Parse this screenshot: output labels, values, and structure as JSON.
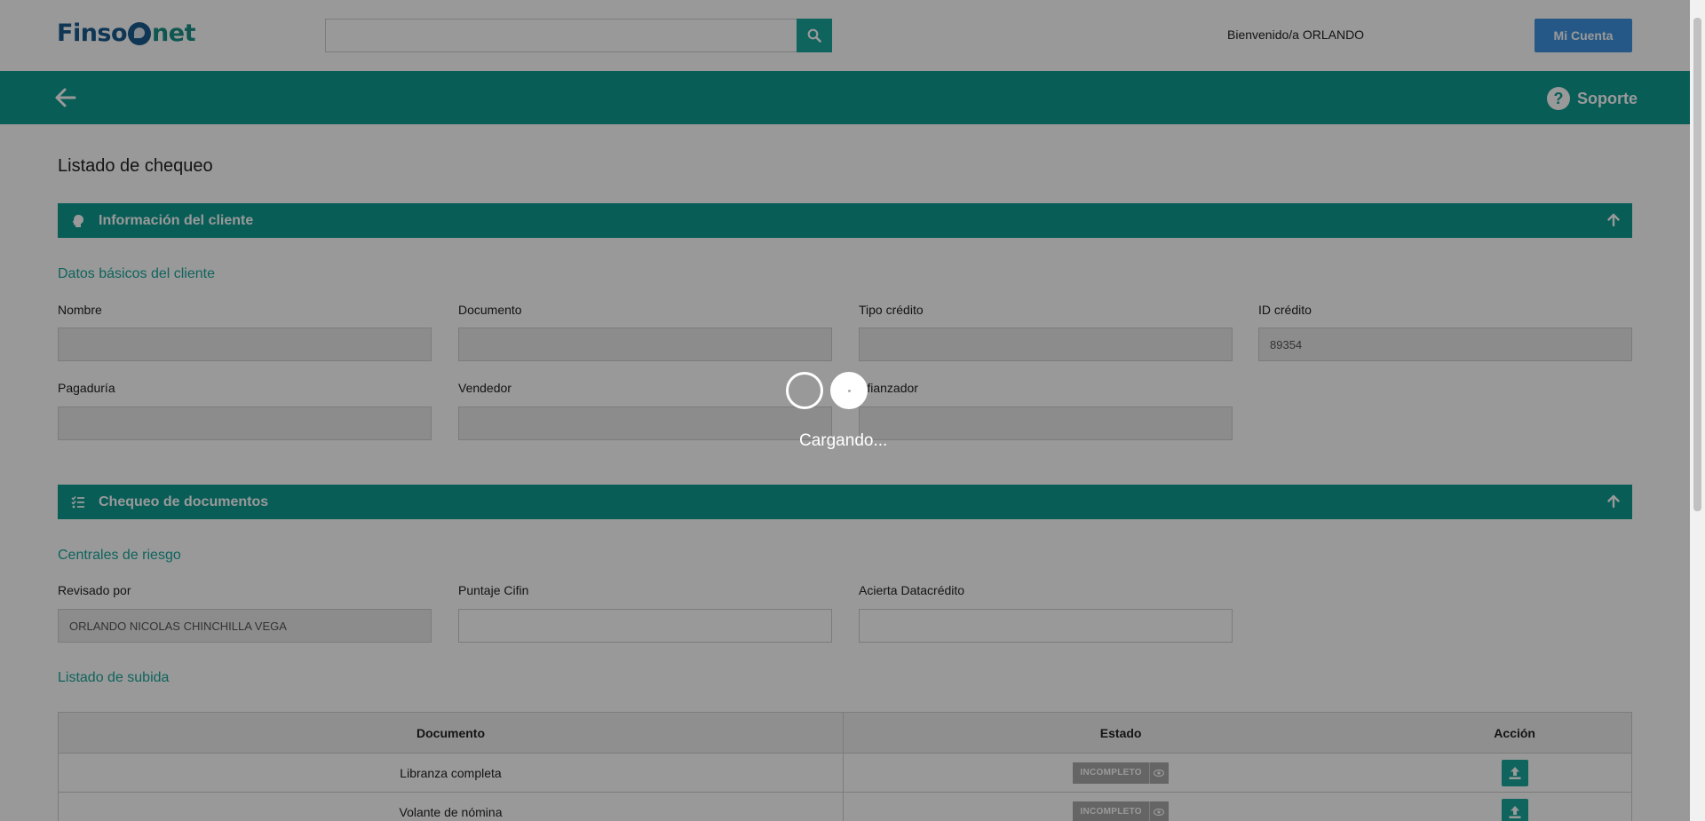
{
  "header": {
    "logo": {
      "part1": "Finso",
      "part2": "net"
    },
    "search": {
      "value": "",
      "placeholder": ""
    },
    "welcome_text": "Bienvenido/a ORLANDO",
    "account_button": "Mi Cuenta"
  },
  "navbar": {
    "support_label": "Soporte"
  },
  "page_title": "Listado de chequeo",
  "client_section": {
    "title": "Información del cliente",
    "subheading": "Datos básicos del cliente",
    "fields": {
      "nombre": {
        "label": "Nombre",
        "value": ""
      },
      "documento": {
        "label": "Documento",
        "value": ""
      },
      "tipo_credito": {
        "label": "Tipo crédito",
        "value": ""
      },
      "id_credito": {
        "label": "ID crédito",
        "value": "89354"
      },
      "pagaduria": {
        "label": "Pagaduría",
        "value": ""
      },
      "vendedor": {
        "label": "Vendedor",
        "value": ""
      },
      "afianzador": {
        "label": "Afianzador",
        "value": ""
      }
    }
  },
  "documents_section": {
    "title": "Chequeo de documentos",
    "risk_subheading": "Centrales de riesgo",
    "fields": {
      "revisado_por": {
        "label": "Revisado por",
        "value": "ORLANDO NICOLAS CHINCHILLA VEGA"
      },
      "puntaje_cifin": {
        "label": "Puntaje Cifin",
        "value": ""
      },
      "acierta_datacredito": {
        "label": "Acierta Datacrédito",
        "value": ""
      }
    },
    "upload_subheading": "Listado de subida",
    "table": {
      "headers": {
        "documento": "Documento",
        "estado": "Estado",
        "accion": "Acción"
      },
      "rows": [
        {
          "documento": "Libranza completa",
          "estado": "INCOMPLETO"
        },
        {
          "documento": "Volante de nómina",
          "estado": "INCOMPLETO"
        }
      ]
    }
  },
  "loading": {
    "text": "Cargando..."
  },
  "colors": {
    "teal": "#0e9b92",
    "teal_light": "#19a79c",
    "account_blue": "#3f93e0",
    "logo_blue": "#1a5a8e",
    "badge_gray": "#a8a8a8"
  }
}
